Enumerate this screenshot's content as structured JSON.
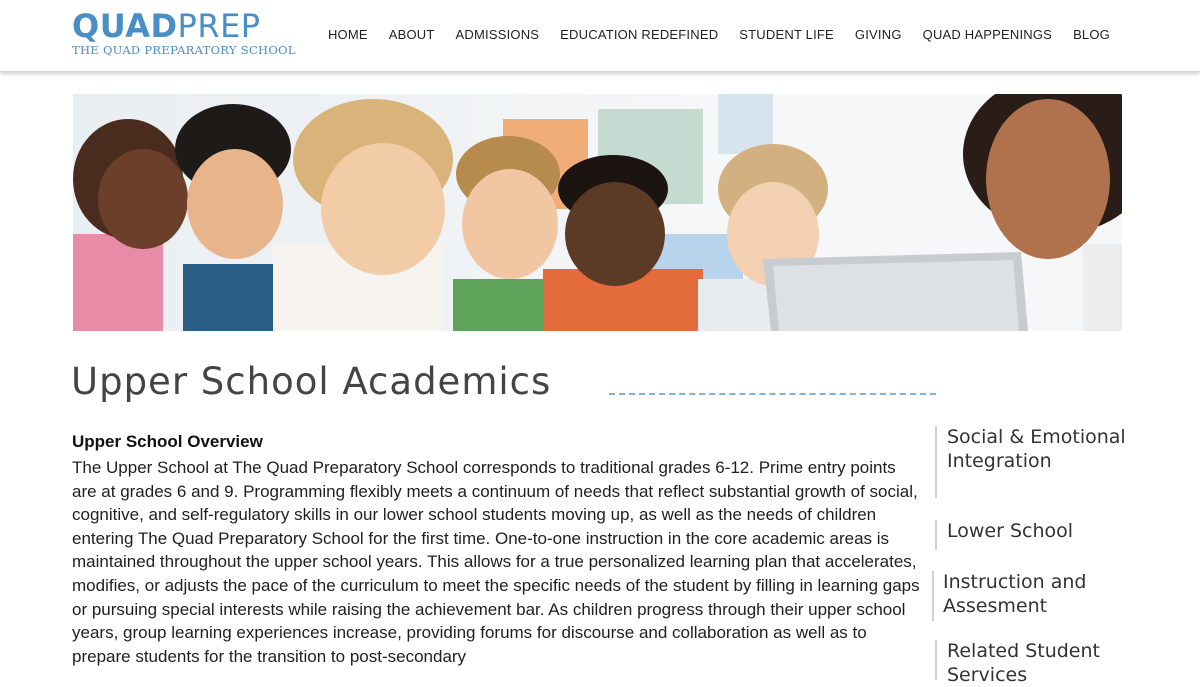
{
  "logo": {
    "part1": "QUAD",
    "part2": "PREP",
    "subtitle": "THE QUAD PREPARATORY SCHOOL"
  },
  "nav": {
    "items": [
      {
        "label": "HOME"
      },
      {
        "label": "ABOUT"
      },
      {
        "label": "ADMISSIONS"
      },
      {
        "label": "EDUCATION REDEFINED"
      },
      {
        "label": "STUDENT LIFE"
      },
      {
        "label": "GIVING"
      },
      {
        "label": "QUAD HAPPENINGS"
      },
      {
        "label": "BLOG"
      }
    ]
  },
  "page": {
    "title": "Upper School Academics",
    "section_heading": "Upper School Overview",
    "body": "The Upper School at The Quad Preparatory School corresponds to traditional grades 6-12. Prime entry points are at grades 6 and 9. Programming flexibly meets a continuum of needs that reflect substantial growth of social, cognitive, and self-regulatory skills in our lower school students moving up, as well as the needs of children entering The Quad Preparatory School for the first time. One-to-one instruction in the core academic areas is maintained throughout the upper school years. This allows for a true personalized learning plan that accelerates, modifies, or adjusts the pace of the curriculum to meet the specific needs of the student by filling in learning gaps or pursuing special interests while raising the achievement bar. As children progress through their upper school years, group learning experiences increase, providing forums for discourse and collaboration as well as to prepare students for the transition to post-secondary"
  },
  "sidebar": {
    "items": [
      {
        "label": "Social & Emotional Integration"
      },
      {
        "label": "Lower School"
      },
      {
        "label": "Instruction and Assesment"
      },
      {
        "label": "Related Student Services"
      }
    ]
  },
  "colors": {
    "brand_blue": "#4a8ec6",
    "title_rule": "#7fb2d8",
    "title_text": "#444444"
  }
}
